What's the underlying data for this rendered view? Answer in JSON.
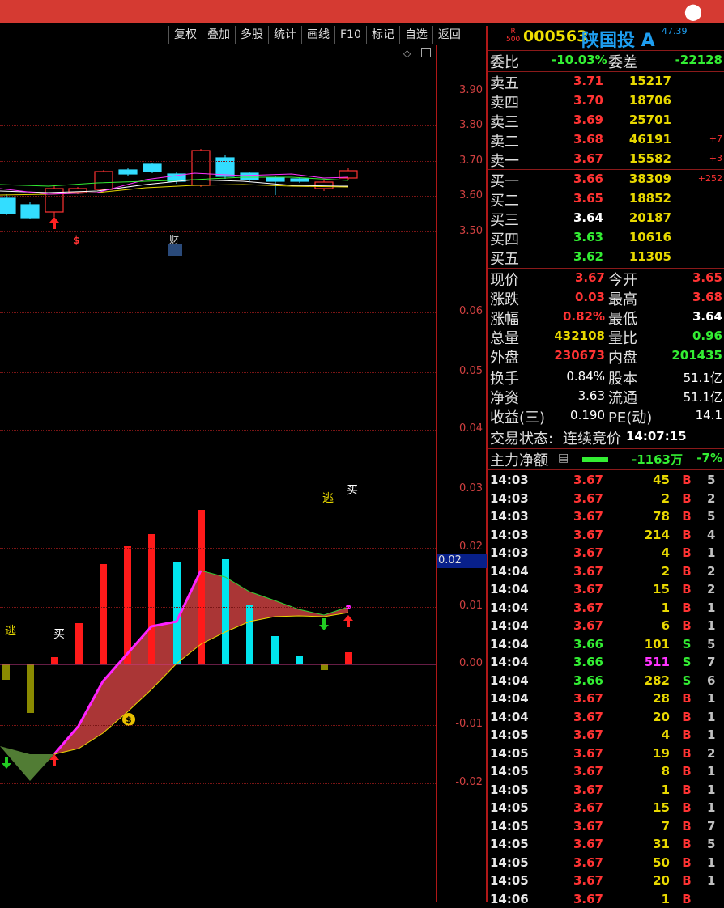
{
  "toolbar": [
    "复权",
    "叠加",
    "多股",
    "统计",
    "画线",
    "F10",
    "标记",
    "自选",
    "返回"
  ],
  "stock": {
    "badge_r": "R",
    "badge_num": "500",
    "code": "000563",
    "name": "陕国投 A",
    "pe": "47.39"
  },
  "weibi": {
    "label": "委比",
    "value": "-10.03%",
    "label2": "委差",
    "value2": "-22128"
  },
  "asks": [
    {
      "label": "卖五",
      "price": "3.71",
      "vol": "15217",
      "chg": ""
    },
    {
      "label": "卖四",
      "price": "3.70",
      "vol": "18706",
      "chg": ""
    },
    {
      "label": "卖三",
      "price": "3.69",
      "vol": "25701",
      "chg": ""
    },
    {
      "label": "卖二",
      "price": "3.68",
      "vol": "46191",
      "chg": "+7"
    },
    {
      "label": "卖一",
      "price": "3.67",
      "vol": "15582",
      "chg": "+3"
    }
  ],
  "bids": [
    {
      "label": "买一",
      "price": "3.66",
      "vol": "38309",
      "chg": "+252"
    },
    {
      "label": "买二",
      "price": "3.65",
      "vol": "18852",
      "chg": ""
    },
    {
      "label": "买三",
      "price": "3.64",
      "vol": "20187",
      "chg": ""
    },
    {
      "label": "买四",
      "price": "3.63",
      "vol": "10616",
      "chg": ""
    },
    {
      "label": "买五",
      "price": "3.62",
      "vol": "11305",
      "chg": ""
    }
  ],
  "stats": [
    {
      "l1": "现价",
      "v1": "3.67",
      "c1": "#ff3333",
      "l2": "今开",
      "v2": "3.65",
      "c2": "#ff3333"
    },
    {
      "l1": "涨跌",
      "v1": "0.03",
      "c1": "#ff3333",
      "l2": "最高",
      "v2": "3.68",
      "c2": "#ff3333"
    },
    {
      "l1": "涨幅",
      "v1": "0.82%",
      "c1": "#ff3333",
      "l2": "最低",
      "v2": "3.64",
      "c2": "#ffffff"
    },
    {
      "l1": "总量",
      "v1": "432108",
      "c1": "#e8d800",
      "l2": "量比",
      "v2": "0.96",
      "c2": "#33ee33"
    },
    {
      "l1": "外盘",
      "v1": "230673",
      "c1": "#ff3333",
      "l2": "内盘",
      "v2": "201435",
      "c2": "#33ee33"
    }
  ],
  "stats2": [
    {
      "l1": "换手",
      "v1": "0.84%",
      "l2": "股本",
      "v2": "51.1亿"
    },
    {
      "l1": "净资",
      "v1": "3.63",
      "l2": "流通",
      "v2": "51.1亿"
    },
    {
      "l1": "收益(三)",
      "v1": "0.190",
      "l2": "PE(动)",
      "v2": "14.1"
    }
  ],
  "trade_status": {
    "label": "交易状态:",
    "value": "连续竞价",
    "time": "14:07:15"
  },
  "main_net": {
    "label": "主力净额",
    "value": "-1163万",
    "pct": "-7%"
  },
  "ticks": [
    {
      "t": "14:03",
      "p": "3.67",
      "v": "45",
      "s": "B",
      "x": "5"
    },
    {
      "t": "14:03",
      "p": "3.67",
      "v": "2",
      "s": "B",
      "x": "2"
    },
    {
      "t": "14:03",
      "p": "3.67",
      "v": "78",
      "s": "B",
      "x": "5"
    },
    {
      "t": "14:03",
      "p": "3.67",
      "v": "214",
      "s": "B",
      "x": "4"
    },
    {
      "t": "14:03",
      "p": "3.67",
      "v": "4",
      "s": "B",
      "x": "1"
    },
    {
      "t": "14:04",
      "p": "3.67",
      "v": "2",
      "s": "B",
      "x": "2"
    },
    {
      "t": "14:04",
      "p": "3.67",
      "v": "15",
      "s": "B",
      "x": "2"
    },
    {
      "t": "14:04",
      "p": "3.67",
      "v": "1",
      "s": "B",
      "x": "1"
    },
    {
      "t": "14:04",
      "p": "3.67",
      "v": "6",
      "s": "B",
      "x": "1"
    },
    {
      "t": "14:04",
      "p": "3.66",
      "v": "101",
      "s": "S",
      "x": "5"
    },
    {
      "t": "14:04",
      "p": "3.66",
      "v": "511",
      "s": "S",
      "x": "7"
    },
    {
      "t": "14:04",
      "p": "3.66",
      "v": "282",
      "s": "S",
      "x": "6"
    },
    {
      "t": "14:04",
      "p": "3.67",
      "v": "28",
      "s": "B",
      "x": "1"
    },
    {
      "t": "14:04",
      "p": "3.67",
      "v": "20",
      "s": "B",
      "x": "1"
    },
    {
      "t": "14:05",
      "p": "3.67",
      "v": "4",
      "s": "B",
      "x": "1"
    },
    {
      "t": "14:05",
      "p": "3.67",
      "v": "19",
      "s": "B",
      "x": "2"
    },
    {
      "t": "14:05",
      "p": "3.67",
      "v": "8",
      "s": "B",
      "x": "1"
    },
    {
      "t": "14:05",
      "p": "3.67",
      "v": "1",
      "s": "B",
      "x": "1"
    },
    {
      "t": "14:05",
      "p": "3.67",
      "v": "15",
      "s": "B",
      "x": "1"
    },
    {
      "t": "14:05",
      "p": "3.67",
      "v": "7",
      "s": "B",
      "x": "7"
    },
    {
      "t": "14:05",
      "p": "3.67",
      "v": "31",
      "s": "B",
      "x": "5"
    },
    {
      "t": "14:05",
      "p": "3.67",
      "v": "50",
      "s": "B",
      "x": "1"
    },
    {
      "t": "14:05",
      "p": "3.67",
      "v": "20",
      "s": "B",
      "x": "1"
    },
    {
      "t": "14:06",
      "p": "3.67",
      "v": "1",
      "s": "B",
      "x": ""
    }
  ],
  "price_axis": [
    "3.90",
    "3.80",
    "3.70",
    "3.60",
    "3.50"
  ],
  "ind_axis": [
    "0.06",
    "0.05",
    "0.04",
    "0.03",
    "0.02",
    "0.01",
    "0.00",
    "-0.01",
    "-0.02"
  ],
  "price_tag": "0.02",
  "marks": {
    "escape": "逃",
    "buy": "买",
    "finance": "财",
    "dollar": "$"
  }
}
